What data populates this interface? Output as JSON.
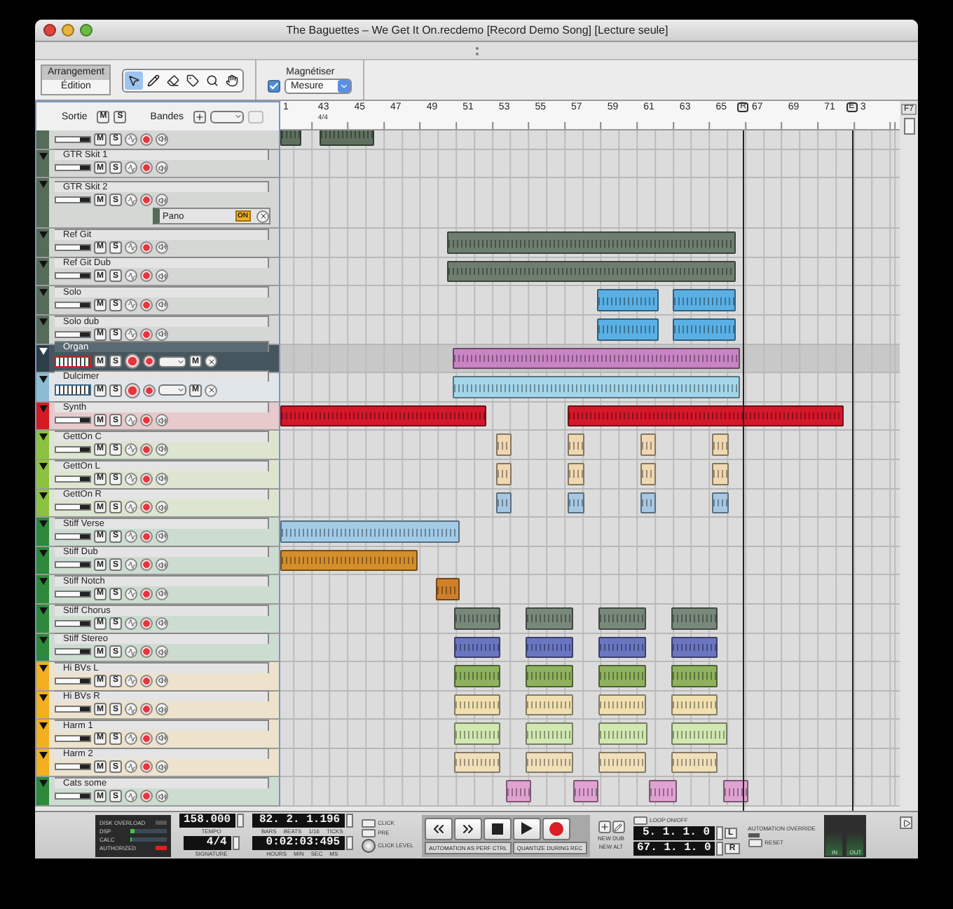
{
  "window": {
    "title": "The Baguettes – We Get It On.recdemo [Record Demo Song] [Lecture seule]"
  },
  "toolbar": {
    "modes": [
      {
        "label": "Arrangement",
        "selected": true
      },
      {
        "label": "Édition",
        "selected": false
      }
    ],
    "tools": [
      {
        "kind": "pointer",
        "selected": true
      },
      {
        "kind": "pencil",
        "selected": false
      },
      {
        "kind": "eraser",
        "selected": false
      },
      {
        "kind": "razor",
        "selected": false
      },
      {
        "kind": "zoom",
        "selected": false
      },
      {
        "kind": "hand",
        "selected": false
      }
    ],
    "snap": {
      "label": "Magnétiser",
      "checked": true,
      "value": "Mesure"
    }
  },
  "track_header": {
    "output_label": "Sortie",
    "mute": "M",
    "solo": "S",
    "lanes_label": "Bandes"
  },
  "ruler": {
    "labels": [
      "1",
      "43",
      "45",
      "47",
      "49",
      "51",
      "53",
      "55",
      "57",
      "59",
      "61",
      "63",
      "65",
      "67",
      "69",
      "71",
      "3"
    ],
    "signature": "4/4",
    "corner_tag": "F7",
    "markers": [
      {
        "label": "R"
      },
      {
        "label": "E"
      }
    ]
  },
  "tracks": [
    {
      "kind": "audio",
      "color": "#566b58",
      "selected": false,
      "mute": "M",
      "solo": "S",
      "clips": [
        {
          "color": "#5f705f"
        },
        {
          "color": "#5f705f"
        }
      ]
    },
    {
      "kind": "audio",
      "name": "GTR Skit 1",
      "color": "#566b58",
      "selected": false,
      "mute": "M",
      "solo": "S"
    },
    {
      "kind": "audio",
      "name": "GTR Skit 2",
      "color": "#566b58",
      "selected": false,
      "mute": "M",
      "solo": "S",
      "lane": {
        "label": "Pano",
        "badge": "ON"
      }
    },
    {
      "kind": "audio",
      "name": "Ref Git",
      "color": "#566b58",
      "selected": false,
      "mute": "M",
      "solo": "S",
      "clips": [
        {
          "color": "#6e7e6e"
        }
      ]
    },
    {
      "kind": "audio",
      "name": "Ref Git Dub",
      "color": "#566b58",
      "selected": false,
      "mute": "M",
      "solo": "S",
      "clips": [
        {
          "color": "#6e7e6e"
        }
      ]
    },
    {
      "kind": "audio",
      "name": "Solo",
      "color": "#566b58",
      "selected": false,
      "mute": "M",
      "solo": "S",
      "clips": [
        {
          "color": "#5ab0e4"
        },
        {
          "color": "#5ab0e4"
        }
      ]
    },
    {
      "kind": "audio",
      "name": "Solo dub",
      "color": "#566b58",
      "selected": false,
      "mute": "M",
      "solo": "S",
      "clips": [
        {
          "color": "#5ab0e4"
        },
        {
          "color": "#5ab0e4"
        }
      ]
    },
    {
      "kind": "instrument",
      "name": "Organ",
      "color": "#2c3f4a",
      "selected": true,
      "mute": "M",
      "solo": "S",
      "device_mute": "M",
      "clips": [
        {
          "color": "#c884c4"
        }
      ]
    },
    {
      "kind": "instrument",
      "name": "Dulcimer",
      "color": "#8cbcd4",
      "selected": false,
      "mute": "M",
      "solo": "S",
      "device_mute": "M",
      "clips": [
        {
          "color": "#a4d6ea"
        }
      ]
    },
    {
      "kind": "audio",
      "name": "Synth",
      "color": "#d41a22",
      "selected": false,
      "mute": "M",
      "solo": "S",
      "clips": [
        {
          "color": "#d4182a"
        },
        {
          "color": "#d4182a"
        }
      ]
    },
    {
      "kind": "audio",
      "name": "GettOn C",
      "color": "#8cc23e",
      "selected": false,
      "mute": "M",
      "solo": "S",
      "clips": [
        {
          "color": "#f0d8b2"
        },
        {
          "color": "#f0d8b2"
        },
        {
          "color": "#f0d8b2"
        },
        {
          "color": "#f0d8b2"
        }
      ]
    },
    {
      "kind": "audio",
      "name": "GettOn L",
      "color": "#8cc23e",
      "selected": false,
      "mute": "M",
      "solo": "S",
      "clips": [
        {
          "color": "#f0d8b2"
        },
        {
          "color": "#f0d8b2"
        },
        {
          "color": "#f0d8b2"
        },
        {
          "color": "#f0d8b2"
        }
      ]
    },
    {
      "kind": "audio",
      "name": "GettOn R",
      "color": "#8cc23e",
      "selected": false,
      "mute": "M",
      "solo": "S",
      "clips": [
        {
          "color": "#a6c8e2"
        },
        {
          "color": "#a6c8e2"
        },
        {
          "color": "#a6c8e2"
        },
        {
          "color": "#a6c8e2"
        }
      ]
    },
    {
      "kind": "audio",
      "name": "Stiff Verse",
      "color": "#2c8a3a",
      "selected": false,
      "mute": "M",
      "solo": "S",
      "clips": [
        {
          "color": "#a2cbe8"
        }
      ]
    },
    {
      "kind": "audio",
      "name": "Stiff Dub",
      "color": "#2c8a3a",
      "selected": false,
      "mute": "M",
      "solo": "S",
      "clips": [
        {
          "color": "#d48e2c"
        }
      ]
    },
    {
      "kind": "audio",
      "name": "Stiff Notch",
      "color": "#2c8a3a",
      "selected": false,
      "mute": "M",
      "solo": "S",
      "clips": [
        {
          "color": "#d0802a"
        }
      ]
    },
    {
      "kind": "audio",
      "name": "Stiff Chorus",
      "color": "#2c8a3a",
      "selected": false,
      "mute": "M",
      "solo": "S",
      "clips": [
        {
          "color": "#78887a"
        },
        {
          "color": "#78887a"
        },
        {
          "color": "#78887a"
        },
        {
          "color": "#78887a"
        }
      ]
    },
    {
      "kind": "audio",
      "name": "Stiff Stereo",
      "color": "#2c8a3a",
      "selected": false,
      "mute": "M",
      "solo": "S",
      "clips": [
        {
          "color": "#6a76c0"
        },
        {
          "color": "#6a76c0"
        },
        {
          "color": "#6a76c0"
        },
        {
          "color": "#6a76c0"
        }
      ]
    },
    {
      "kind": "audio",
      "name": "Hi BVs L",
      "color": "#f2b020",
      "selected": false,
      "mute": "M",
      "solo": "S",
      "clips": [
        {
          "color": "#8fb25e"
        },
        {
          "color": "#8fb25e"
        },
        {
          "color": "#8fb25e"
        },
        {
          "color": "#8fb25e"
        }
      ]
    },
    {
      "kind": "audio",
      "name": "Hi BVs R",
      "color": "#f2b020",
      "selected": false,
      "mute": "M",
      "solo": "S",
      "clips": [
        {
          "color": "#f0e0b0"
        },
        {
          "color": "#f0e0b0"
        },
        {
          "color": "#f0e0b0"
        },
        {
          "color": "#f0e0b0"
        }
      ]
    },
    {
      "kind": "audio",
      "name": "Harm 1",
      "color": "#f2b020",
      "selected": false,
      "mute": "M",
      "solo": "S",
      "clips": [
        {
          "color": "#d2e8b2"
        },
        {
          "color": "#d2e8b2"
        },
        {
          "color": "#d2e8b2"
        },
        {
          "color": "#d2e8b2"
        }
      ]
    },
    {
      "kind": "audio",
      "name": "Harm 2",
      "color": "#f2b020",
      "selected": false,
      "mute": "M",
      "solo": "S",
      "clips": [
        {
          "color": "#f0e0ba"
        },
        {
          "color": "#f0e0ba"
        },
        {
          "color": "#f0e0ba"
        },
        {
          "color": "#f0e0ba"
        }
      ]
    },
    {
      "kind": "audio",
      "name": "Cats some",
      "color": "#2c8a3a",
      "selected": false,
      "mute": "M",
      "solo": "S",
      "clips": [
        {
          "color": "#e0a2d2"
        },
        {
          "color": "#e0a2d2"
        },
        {
          "color": "#e0a2d2"
        },
        {
          "color": "#e0a2d2"
        }
      ]
    }
  ],
  "transport": {
    "status": [
      {
        "label": "DISK OVERLOAD",
        "kind": "led",
        "on": false
      },
      {
        "label": "DSP",
        "kind": "meter",
        "level": 0.1
      },
      {
        "label": "CALC",
        "kind": "meter",
        "level": 0.05
      },
      {
        "label": "AUTHORIZED",
        "kind": "led",
        "on": true
      }
    ],
    "tempo": {
      "value": "158.000",
      "label": "TEMPO"
    },
    "signature": {
      "value": "4/4",
      "label": "SIGNATURE"
    },
    "position": {
      "value": "82. 2. 1.196",
      "labels": [
        "BARS",
        "BEATS",
        "1/16",
        "TICKS"
      ]
    },
    "time": {
      "value": "0:02:03:495",
      "labels": [
        "HOURS",
        "MIN",
        "SEC",
        "MS"
      ]
    },
    "click": "CLICK",
    "pre": "PRE",
    "click_level": "CLICK LEVEL",
    "buttons": [
      {
        "kind": "rewind"
      },
      {
        "kind": "forward"
      },
      {
        "kind": "stop"
      },
      {
        "kind": "play"
      },
      {
        "kind": "record"
      }
    ],
    "automation_perf": "AUTOMATION AS PERF CTRL",
    "quantize": "QUANTIZE DURING REC",
    "new_dub": "NEW DUB",
    "new_alt": "NEW ALT",
    "loop": "LOOP ON/OFF",
    "left_locator": {
      "value": "5. 1. 1. 0",
      "tag": "L"
    },
    "right_locator": {
      "value": "67. 1. 1. 0",
      "tag": "R"
    },
    "automation_override": "AUTOMATION OVERRIDE",
    "reset": "RESET",
    "meter": [
      "IN",
      "OUT"
    ]
  }
}
